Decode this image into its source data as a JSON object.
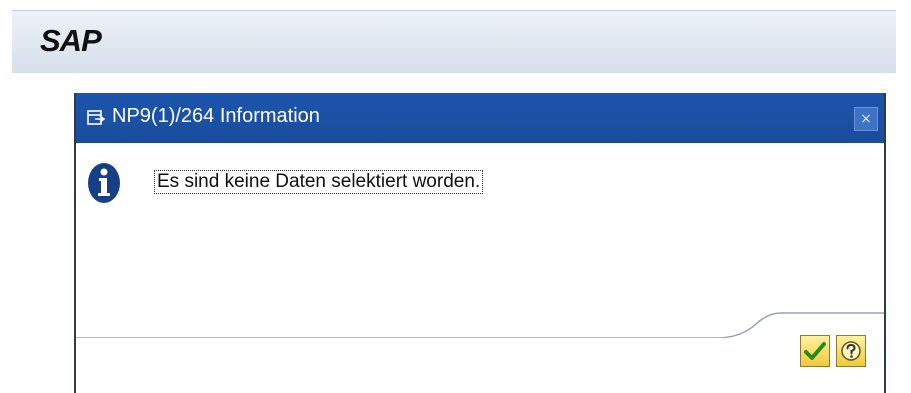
{
  "app": {
    "logo": "SAP"
  },
  "dialog": {
    "title": "NP9(1)/264 Information",
    "close_symbol": "×",
    "message": "Es sind keine Daten selektiert worden.",
    "message_type": "information",
    "icons": {
      "title": "dialog-window-icon",
      "message": "info-icon",
      "confirm": "checkmark-icon",
      "help": "help-icon"
    }
  },
  "colors": {
    "titlebar": "#1d55ad",
    "info_icon": "#173f86",
    "button_yellow": "#f0c93a",
    "checkmark": "#2c8a1c"
  }
}
